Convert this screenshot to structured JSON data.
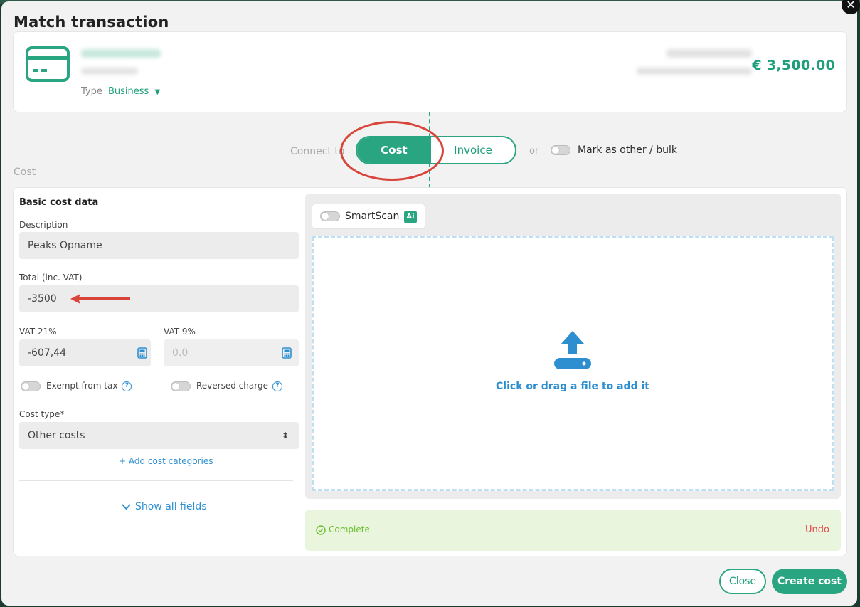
{
  "modal": {
    "title": "Match transaction",
    "close_symbol": "✕"
  },
  "transaction": {
    "type_label": "Type",
    "type_value": "Business",
    "amount": "€ 3,500.00"
  },
  "connect": {
    "label": "Connect to",
    "option_cost": "Cost",
    "option_invoice": "Invoice",
    "or_label": "or",
    "mark_other_label": "Mark as other / bulk"
  },
  "cost_section": {
    "heading": "Cost",
    "basic_title": "Basic cost data",
    "description_label": "Description",
    "description_value": "Peaks Opname",
    "total_label": "Total (inc. VAT)",
    "total_value": "-3500",
    "vat21_label": "VAT 21%",
    "vat21_value": "-607,44",
    "vat9_label": "VAT 9%",
    "vat9_placeholder": "0.0",
    "exempt_label": "Exempt from tax",
    "reversed_label": "Reversed charge",
    "help_symbol": "?",
    "cost_type_label": "Cost type*",
    "cost_type_value": "Other costs",
    "sort_symbol": "⬍",
    "add_categories": "+ Add cost categories",
    "show_all": "Show all fields",
    "show_all_chevron": "⌄"
  },
  "upload": {
    "smartscan_label": "SmartScan",
    "ai_badge": "Ai",
    "drop_text": "Click or drag a file to add it"
  },
  "status": {
    "complete_label": "Complete",
    "complete_symbol": "✓",
    "undo_label": "Undo"
  },
  "footer": {
    "close_label": "Close",
    "create_label": "Create cost"
  },
  "colors": {
    "accent": "#2aa581",
    "link": "#2e8fd0",
    "danger": "#e24a4a",
    "annotation": "#d9453a"
  }
}
